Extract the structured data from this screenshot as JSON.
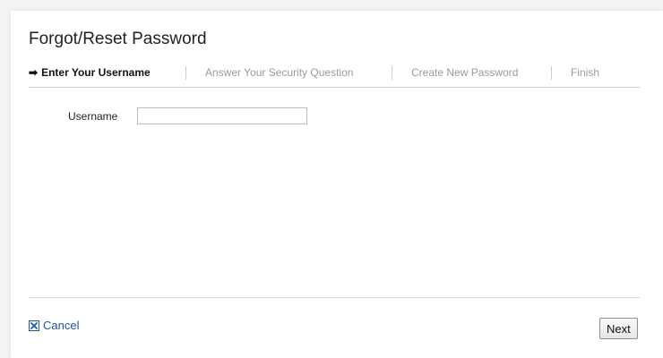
{
  "page": {
    "title": "Forgot/Reset Password"
  },
  "steps": {
    "active_marker": "➡",
    "items": [
      {
        "label": "Enter Your Username",
        "state": "active"
      },
      {
        "label": "Answer Your Security Question",
        "state": "inactive"
      },
      {
        "label": "Create New Password",
        "state": "inactive"
      },
      {
        "label": "Finish",
        "state": "inactive"
      }
    ]
  },
  "form": {
    "username_label": "Username",
    "username_value": "",
    "username_placeholder": ""
  },
  "footer": {
    "cancel_label": "Cancel",
    "cancel_icon": "close-box-icon",
    "next_label": "Next"
  },
  "colors": {
    "link": "#1f56a6",
    "active_step": "#111111",
    "inactive_step": "#9a9a9a"
  }
}
